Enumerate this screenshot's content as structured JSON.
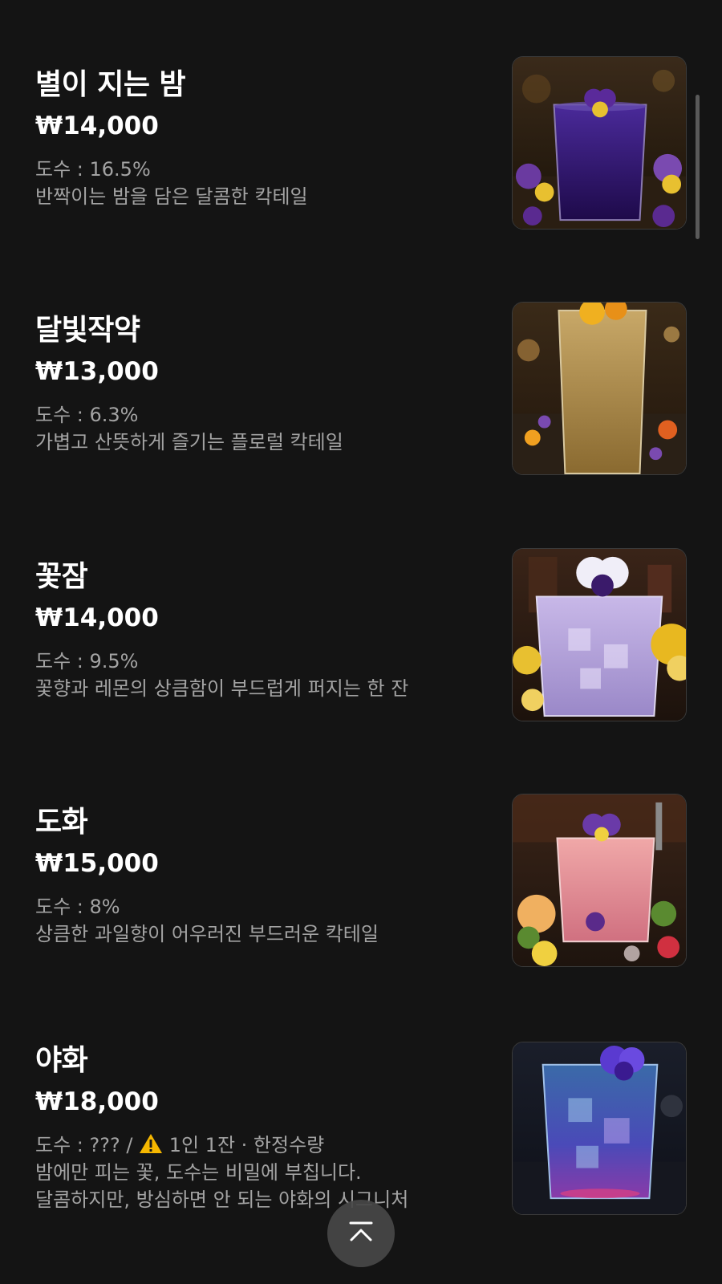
{
  "currency_symbol": "₩",
  "items": [
    {
      "name": "별이 지는 밤",
      "price": "₩14,000",
      "abv": "도수 : 16.5%",
      "description": "반짝이는 밤을 담은 달콤한 칵테일",
      "image_alt": "purple cocktail with pansy flowers"
    },
    {
      "name": "달빛작약",
      "price": "₩13,000",
      "abv": "도수 : 6.3%",
      "description": "가볍고 산뜻하게 즐기는 플로럴 칵테일",
      "image_alt": "golden highball cocktail with flowers"
    },
    {
      "name": "꽃잠",
      "price": "₩14,000",
      "abv": "도수 : 9.5%",
      "description": "꽃향과 레몬의 상큼함이 부드럽게 퍼지는 한 잔",
      "image_alt": "lavender cocktail with white pansy and lemons"
    },
    {
      "name": "도화",
      "price": "₩15,000",
      "abv": "도수 : 8%",
      "description": "상큼한 과일향이 어우러진 부드러운 칵테일",
      "image_alt": "pink fruit cocktail with pansy and berries"
    },
    {
      "name": "야화",
      "price": "₩18,000",
      "abv": "도수 : ??? / ",
      "abv_notice": "1인 1잔 · 한정수량",
      "description": "밤에만 피는 꽃, 도수는 비밀에 부칩니다.",
      "description2": "달콤하지만, 방심하면 안 되는 야화의 시그니처",
      "image_alt": "blue glowing cocktail with purple pansy"
    }
  ],
  "icons": {
    "warning": "warning-icon",
    "scroll_top": "chevron-up-icon"
  },
  "colors": {
    "background": "#141414",
    "text_primary": "#ffffff",
    "text_secondary": "#a3a3a3",
    "warning": "#f5b700"
  }
}
